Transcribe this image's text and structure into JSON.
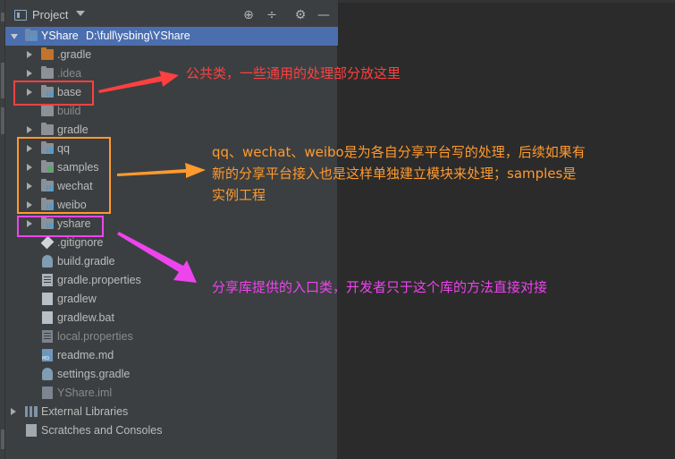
{
  "panel": {
    "title": "Project",
    "tools": {
      "locate": "⊕",
      "collapse": "÷",
      "settings": "⚙",
      "hide": "—"
    }
  },
  "tree": {
    "root": {
      "name": "YShare",
      "path": "D:\\full\\ysbing\\YShare"
    },
    "items": [
      {
        "label": ".gradle"
      },
      {
        "label": ".idea"
      },
      {
        "label": "base"
      },
      {
        "label": "build"
      },
      {
        "label": "gradle"
      },
      {
        "label": "qq"
      },
      {
        "label": "samples"
      },
      {
        "label": "wechat"
      },
      {
        "label": "weibo"
      },
      {
        "label": "yshare"
      },
      {
        "label": ".gitignore"
      },
      {
        "label": "build.gradle"
      },
      {
        "label": "gradle.properties"
      },
      {
        "label": "gradlew"
      },
      {
        "label": "gradlew.bat"
      },
      {
        "label": "local.properties"
      },
      {
        "label": "readme.md"
      },
      {
        "label": "settings.gradle"
      },
      {
        "label": "YShare.iml"
      }
    ],
    "external_libraries": "External Libraries",
    "scratches": "Scratches and Consoles"
  },
  "annotations": {
    "base_note": "公共类，一些通用的处理部分放这里",
    "platform_note_1": "qq、wechat、weibo是为各自分享平台写的处理，后续如果有",
    "platform_note_2": "新的分享平台接入也是这样单独建立模块来处理；samples是",
    "platform_note_3": "实例工程",
    "yshare_note": "分享库提供的入口类，开发者只于这个库的方法直接对接"
  },
  "colors": {
    "red": "#ff4040",
    "orange": "#ff9a2e",
    "magenta": "#ee44ee",
    "selection": "#4b6eaf"
  }
}
